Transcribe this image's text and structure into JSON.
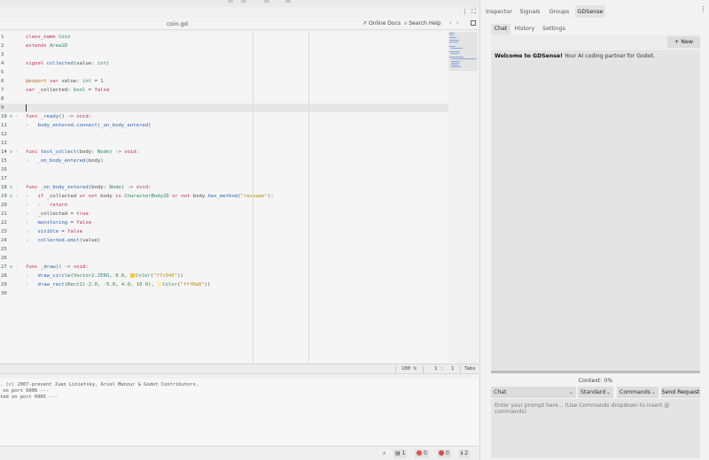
{
  "editor": {
    "file_title": "coin.gd",
    "online_docs_label": "Online Docs",
    "search_help_label": "Search Help",
    "nav_back": "‹",
    "nav_forward": "›",
    "menu_dots": "⋮",
    "expand_icon": "⛶"
  },
  "code_lines": [
    {
      "n": "1",
      "html": "<span class=\"kw\">class_name</span> <span class=\"ty\">Coin</span>"
    },
    {
      "n": "2",
      "html": "<span class=\"kw\">extends</span> <span class=\"ty\">Area2D</span>"
    },
    {
      "n": "3",
      "html": ""
    },
    {
      "n": "4",
      "html": "<span class=\"kw\">signal</span> <span class=\"fn\">collected</span>(value: <span class=\"ty\">int</span>)"
    },
    {
      "n": "5",
      "html": ""
    },
    {
      "n": "6",
      "html": "<span class=\"an\">@export</span> <span class=\"kw\">var</span> value: <span class=\"ty\">int</span> = <span class=\"nu\">1</span>"
    },
    {
      "n": "7",
      "html": "<span class=\"kw\">var</span> _collected: <span class=\"ty\">bool</span> = <span class=\"kw\">false</span>"
    },
    {
      "n": "8",
      "html": ""
    },
    {
      "n": "9",
      "html": "",
      "current": true
    },
    {
      "n": "10",
      "html": "<span class=\"kw\">func</span> <span class=\"fn\">_ready</span>() -&gt; <span class=\"kw\">void</span>:",
      "fold": "v ·"
    },
    {
      "n": "11",
      "html": "<span class=\"indent-guide\">»</span>   <span class=\"fn\">body_entered</span>.<span class=\"fn\">connect</span>(<span class=\"fn\">_on_body_entered</span>)"
    },
    {
      "n": "12",
      "html": ""
    },
    {
      "n": "13",
      "html": ""
    },
    {
      "n": "14",
      "html": "<span class=\"kw\">func</span> <span class=\"fn\">test_collect</span>(body: <span class=\"ty\">Node</span>) -&gt; <span class=\"kw\">void</span>:",
      "fold": "v ·"
    },
    {
      "n": "15",
      "html": "<span class=\"indent-guide\">»</span>   <span class=\"fn\">_on_body_entered</span>(body)"
    },
    {
      "n": "16",
      "html": ""
    },
    {
      "n": "17",
      "html": ""
    },
    {
      "n": "18",
      "html": "<span class=\"kw\">func</span> <span class=\"fn\">_on_body_entered</span>(body: <span class=\"ty\">Node</span>) -&gt; <span class=\"kw\">void</span>:",
      "fold": "v ·"
    },
    {
      "n": "19",
      "html": "<span class=\"indent-guide\">»</span>   <span class=\"kw\">if</span> _collected <span class=\"kw\">or</span> <span class=\"kw\">not</span> body <span class=\"kw\">is</span> <span class=\"ty\">CharacterBody2D</span> <span class=\"kw\">or</span> <span class=\"kw\">not</span> body.<span class=\"fn\">has_method</span>(<span class=\"st\">\"respawn\"</span>):",
      "fold": "v ·"
    },
    {
      "n": "20",
      "html": "<span class=\"indent-guide\">»</span>   <span class=\"indent-guide\">»</span>   <span class=\"kw\">return</span>"
    },
    {
      "n": "21",
      "html": "<span class=\"indent-guide\">»</span>   _collected = <span class=\"kw\">true</span>"
    },
    {
      "n": "22",
      "html": "<span class=\"indent-guide\">»</span>   <span class=\"fn\">monitoring</span> = <span class=\"kw\">false</span>"
    },
    {
      "n": "23",
      "html": "<span class=\"indent-guide\">»</span>   <span class=\"fn\">visible</span> = <span class=\"kw\">false</span>"
    },
    {
      "n": "24",
      "html": "<span class=\"indent-guide\">»</span>   <span class=\"fn\">collected</span>.<span class=\"fn\">emit</span>(value)"
    },
    {
      "n": "25",
      "html": ""
    },
    {
      "n": "26",
      "html": ""
    },
    {
      "n": "27",
      "html": "<span class=\"kw\">func</span> <span class=\"fn\">_draw</span>() -&gt; <span class=\"kw\">void</span>:",
      "fold": "v ·"
    },
    {
      "n": "28",
      "html": "<span class=\"indent-guide\">»</span>   <span class=\"fn\">draw_circle</span>(<span class=\"ty\">Vector2</span>.<span class=\"cl\">ZERO</span>, <span class=\"nu\">8.0</span>, <span class=\"sw\" style=\"background:#f7c945\"></span><span class=\"ty\">Color</span>(<span class=\"st\">\"f7c945\"</span>))"
    },
    {
      "n": "29",
      "html": "<span class=\"indent-guide\">»</span>   <span class=\"fn\">draw_rect</span>(<span class=\"ty\">Rect2</span>(<span class=\"nu\">-2.0</span>, <span class=\"nu\">-5.0</span>, <span class=\"nu\">4.0</span>, <span class=\"nu\">10.0</span>), <span class=\"sw\" style=\"background:#fff0a0\"></span><span class=\"ty\">Color</span>(<span class=\"st\">\"fff0a0\"</span>))"
    },
    {
      "n": "30",
      "html": ""
    }
  ],
  "status": {
    "zoom": "100 %",
    "line": "1",
    "column": "1",
    "indent_mode": "Tabs"
  },
  "output_lines": [
    ". (c) 2007-present Juan Linietsky, Ariel Manzur & Godot Contributors.",
    " on port 6006 ---",
    "ted on port 6005 ---"
  ],
  "bottom_bar": {
    "messages_count": "1",
    "errors_count": "0",
    "warnings_count": "0",
    "debug_count": "2"
  },
  "dock_tabs": [
    "Inspector",
    "Signals",
    "Groups",
    "GDSense"
  ],
  "gdsense": {
    "tabs": [
      "Chat",
      "History",
      "Settings"
    ],
    "new_chat_label": "+ New Chat",
    "welcome_bold": "Welcome to GDSense!",
    "welcome_rest": " Your AI coding partner for Godot.",
    "context": "Context: 0%",
    "mode_select": "Chat",
    "level_select": "Standard",
    "commands_select": "Commands",
    "send_label": "Send Request",
    "prompt_placeholder": "Enter your prompt here... (Use Commands dropdown to insert @ commands)"
  },
  "colors": {
    "swatch_yellow": "#f7c945",
    "swatch_light_yellow": "#fff0a0",
    "error_red": "#e05252",
    "warning_red": "#d94848"
  }
}
